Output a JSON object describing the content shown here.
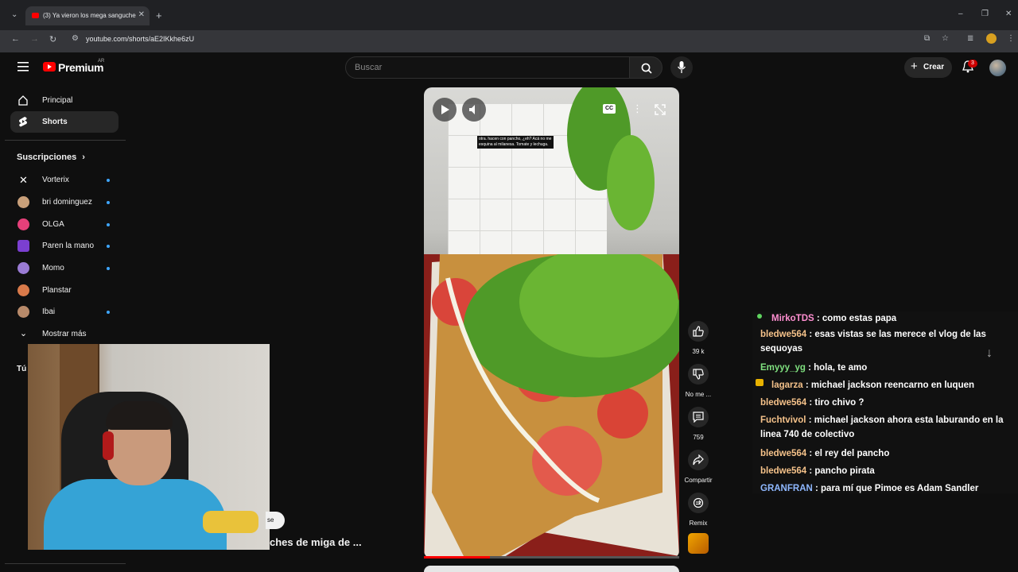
{
  "browser": {
    "tab_title": "(3) Ya vieron los mega sanguche",
    "url": "youtube.com/shorts/aE2IKkhe6zU"
  },
  "header": {
    "logo_text": "Premium",
    "region": "AR",
    "search_placeholder": "Buscar",
    "create_label": "Crear",
    "notification_count": "3"
  },
  "sidebar": {
    "main": [
      {
        "label": "Principal",
        "icon": "home-icon"
      },
      {
        "label": "Shorts",
        "icon": "shorts-icon"
      }
    ],
    "subscriptions_title": "Suscripciones",
    "subscriptions": [
      {
        "label": "Vorterix",
        "color": "#ffffff"
      },
      {
        "label": "bri dominguez",
        "color": "#c9a07a"
      },
      {
        "label": "OLGA",
        "color": "#e6407a"
      },
      {
        "label": "Paren la mano",
        "color": "#7b3fd1"
      },
      {
        "label": "Momo",
        "color": "#9a7bd4"
      },
      {
        "label": "Planstar",
        "color": "#d97a4a"
      },
      {
        "label": "Ibai",
        "color": "#b88a6a"
      }
    ],
    "show_more": "Mostrar más",
    "you_partial": "Tú"
  },
  "video": {
    "caption": "otra. hacen con pancho, ¿eh? Acá no me esquina al milanesa. Tomate y lechuga.",
    "progress": 0.26
  },
  "actions": {
    "likes": "39 k",
    "dislike": "No me ...",
    "comments": "759",
    "share": "Compartir",
    "remix": "Remix"
  },
  "behind": {
    "title": "ches de miga de ...",
    "pill": "se"
  },
  "chat": [
    {
      "user": "MirkoTDS",
      "text": ": como estas papa",
      "color": "#ff8fd1"
    },
    {
      "user": "bledwe564",
      "text": ": esas vistas se las merece el vlog de las sequoyas",
      "color": "#f5c28a"
    },
    {
      "user": "Emyyy_yg",
      "text": ": hola, te amo",
      "color": "#7fe07f"
    },
    {
      "user": "lagarza",
      "text": ": michael jackson reencarno en luquen",
      "color": "#f5c28a"
    },
    {
      "user": "bledwe564",
      "text": ": tiro chivo ?",
      "color": "#f5c28a"
    },
    {
      "user": "Fuchtvivol",
      "text": ": michael jackson ahora esta laburando en la linea 740 de colectivo",
      "color": "#f5c28a"
    },
    {
      "user": "bledwe564",
      "text": ": el rey del pancho",
      "color": "#f5c28a"
    },
    {
      "user": "bledwe564",
      "text": ": pancho pirata",
      "color": "#f5c28a"
    },
    {
      "user": "GRANFRAN",
      "text": ": para mí que Pimoe es Adam Sandler",
      "color": "#8fb8ff"
    }
  ]
}
